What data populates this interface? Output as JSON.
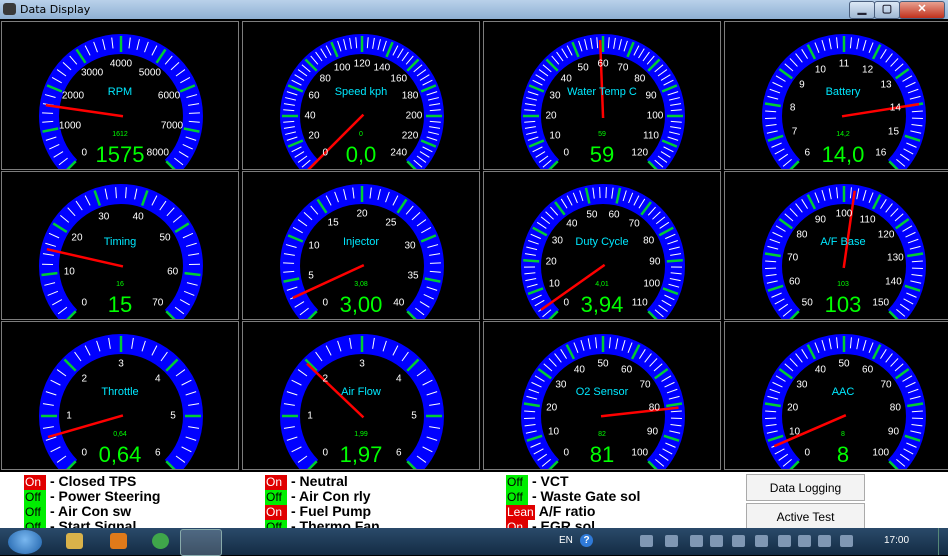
{
  "window": {
    "title": "Data Display",
    "min_glyph": "▁",
    "max_glyph": "▢",
    "close_glyph": "✕"
  },
  "gauges": [
    {
      "label": "RPM",
      "value": "1575",
      "small": "1612",
      "ticks": [
        "0",
        "1000",
        "2000",
        "3000",
        "4000",
        "5000",
        "6000",
        "7000",
        "8000"
      ],
      "needle_fraction": 0.197
    },
    {
      "label": "Speed kph",
      "value": "0,0",
      "small": "0",
      "ticks": [
        "0",
        "20",
        "40",
        "60",
        "80",
        "100",
        "120",
        "140",
        "160",
        "180",
        "200",
        "220",
        "240"
      ],
      "needle_fraction": 0.0
    },
    {
      "label": "Water Temp C",
      "value": "59",
      "small": "59",
      "ticks": [
        "0",
        "10",
        "20",
        "30",
        "40",
        "50",
        "60",
        "70",
        "80",
        "90",
        "100",
        "110",
        "120"
      ],
      "needle_fraction": 0.492
    },
    {
      "label": "Battery",
      "value": "14,0",
      "small": "14,2",
      "ticks": [
        "6",
        "7",
        "8",
        "9",
        "10",
        "11",
        "12",
        "13",
        "14",
        "15",
        "16"
      ],
      "needle_fraction": 0.8
    },
    {
      "label": "Timing",
      "value": "15",
      "small": "16",
      "ticks": [
        "0",
        "10",
        "20",
        "30",
        "40",
        "50",
        "60",
        "70"
      ],
      "needle_fraction": 0.214
    },
    {
      "label": "Injector",
      "value": "3,00",
      "small": "3,08",
      "ticks": [
        "0",
        "5",
        "10",
        "15",
        "20",
        "25",
        "30",
        "35",
        "40"
      ],
      "needle_fraction": 0.075
    },
    {
      "label": "Duty Cycle",
      "value": "3,94",
      "small": "4,01",
      "ticks": [
        "0",
        "10",
        "20",
        "30",
        "40",
        "50",
        "60",
        "70",
        "80",
        "90",
        "100",
        "110"
      ],
      "needle_fraction": 0.036
    },
    {
      "label": "A/F Base",
      "value": "103",
      "small": "103",
      "ticks": [
        "50",
        "60",
        "70",
        "80",
        "90",
        "100",
        "110",
        "120",
        "130",
        "140",
        "150"
      ],
      "needle_fraction": 0.53
    },
    {
      "label": "Throttle",
      "value": "0,64",
      "small": "0,64",
      "ticks": [
        "0",
        "1",
        "2",
        "3",
        "4",
        "5",
        "6"
      ],
      "needle_fraction": 0.107
    },
    {
      "label": "Air Flow",
      "value": "1,97",
      "small": "1,99",
      "ticks": [
        "0",
        "1",
        "2",
        "3",
        "4",
        "5",
        "6"
      ],
      "needle_fraction": 0.328
    },
    {
      "label": "O2 Sensor",
      "value": "81",
      "small": "82",
      "ticks": [
        "0",
        "10",
        "20",
        "30",
        "40",
        "50",
        "60",
        "70",
        "80",
        "90",
        "100"
      ],
      "needle_fraction": 0.81
    },
    {
      "label": "AAC",
      "value": "8",
      "small": "8",
      "ticks": [
        "0",
        "10",
        "20",
        "30",
        "40",
        "50",
        "60",
        "70",
        "80",
        "90",
        "100"
      ],
      "needle_fraction": 0.08
    }
  ],
  "status": [
    {
      "indicator": "On",
      "color": "#e00000",
      "label": "- Closed TPS"
    },
    {
      "indicator": "Off",
      "color": "#00ee00",
      "label": "- Power Steering"
    },
    {
      "indicator": "Off",
      "color": "#00ee00",
      "label": "- Air Con sw"
    },
    {
      "indicator": "Off",
      "color": "#00ee00",
      "label": "- Start Signal"
    },
    {
      "indicator": "On",
      "color": "#e00000",
      "label": "- Neutral"
    },
    {
      "indicator": "Off",
      "color": "#00ee00",
      "label": "- Air Con rly"
    },
    {
      "indicator": "On",
      "color": "#e00000",
      "label": "- Fuel Pump"
    },
    {
      "indicator": "Off",
      "color": "#00ee00",
      "label": "- Thermo Fan"
    },
    {
      "indicator": "Off",
      "color": "#00ee00",
      "label": "- VCT"
    },
    {
      "indicator": "Off",
      "color": "#00ee00",
      "label": "- Waste Gate sol"
    },
    {
      "indicator": "Lean",
      "color": "#e00000",
      "label": "A/F ratio"
    },
    {
      "indicator": "On",
      "color": "#e00000",
      "label": "- EGR sol"
    }
  ],
  "buttons": {
    "data_logging": "Data Logging",
    "active_test": "Active Test"
  },
  "taskbar": {
    "language": "EN",
    "help": "?",
    "clock": "17:00"
  },
  "colors": {
    "dial_blue": "#0000ff",
    "tick_green": "#00cc33",
    "needle_red": "#ff0000",
    "value_green": "#00ff00",
    "label_cyan": "#00e8ff"
  }
}
